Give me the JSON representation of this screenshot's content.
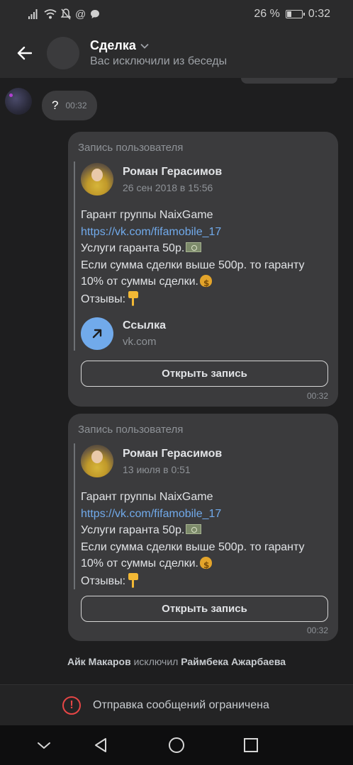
{
  "status_bar": {
    "battery_text": "26 %",
    "battery_level": 0.26,
    "time": "0:32",
    "icons": [
      "signal-icon",
      "wifi-icon",
      "mute-icon",
      "at-icon",
      "chat-notification-icon"
    ]
  },
  "header": {
    "title": "Сделка",
    "subtitle": "Вас исключили из беседы"
  },
  "incoming_message": {
    "text": "?",
    "time": "00:32"
  },
  "posts": [
    {
      "label": "Запись пользователя",
      "author": "Роман Герасимов",
      "date": "26 сен 2018 в 15:56",
      "line1": "Гарант группы NaixGame",
      "link": "https://vk.com/fifamobile_17",
      "line3": "Услуги гаранта 50р.",
      "line4": "Если сумма сделки выше 500р. то гаранту",
      "line5": "10% от суммы сделки.",
      "line6": "Отзывы:",
      "attachment_title": "Ссылка",
      "attachment_domain": "vk.com",
      "button": "Открыть запись",
      "time": "00:32"
    },
    {
      "label": "Запись пользователя",
      "author": "Роман Герасимов",
      "date": "13 июля в 0:51",
      "line1": "Гарант группы NaixGame",
      "link": "https://vk.com/fifamobile_17",
      "line3": "Услуги гаранта 50р.",
      "line4": "Если сумма сделки выше 500р. то гаранту",
      "line5": "10% от суммы сделки.",
      "line6": "Отзывы:",
      "button": "Открыть запись",
      "time": "00:32"
    }
  ],
  "system_message": {
    "actor": "Айк Макаров",
    "action": "исключил",
    "target": "Раймбека Ажарбаева"
  },
  "restricted_notice": "Отправка сообщений ограничена",
  "colors": {
    "background": "#1e1e1f",
    "bubble": "#3b3b3d",
    "link": "#71aaeb",
    "warning": "#e64646"
  }
}
